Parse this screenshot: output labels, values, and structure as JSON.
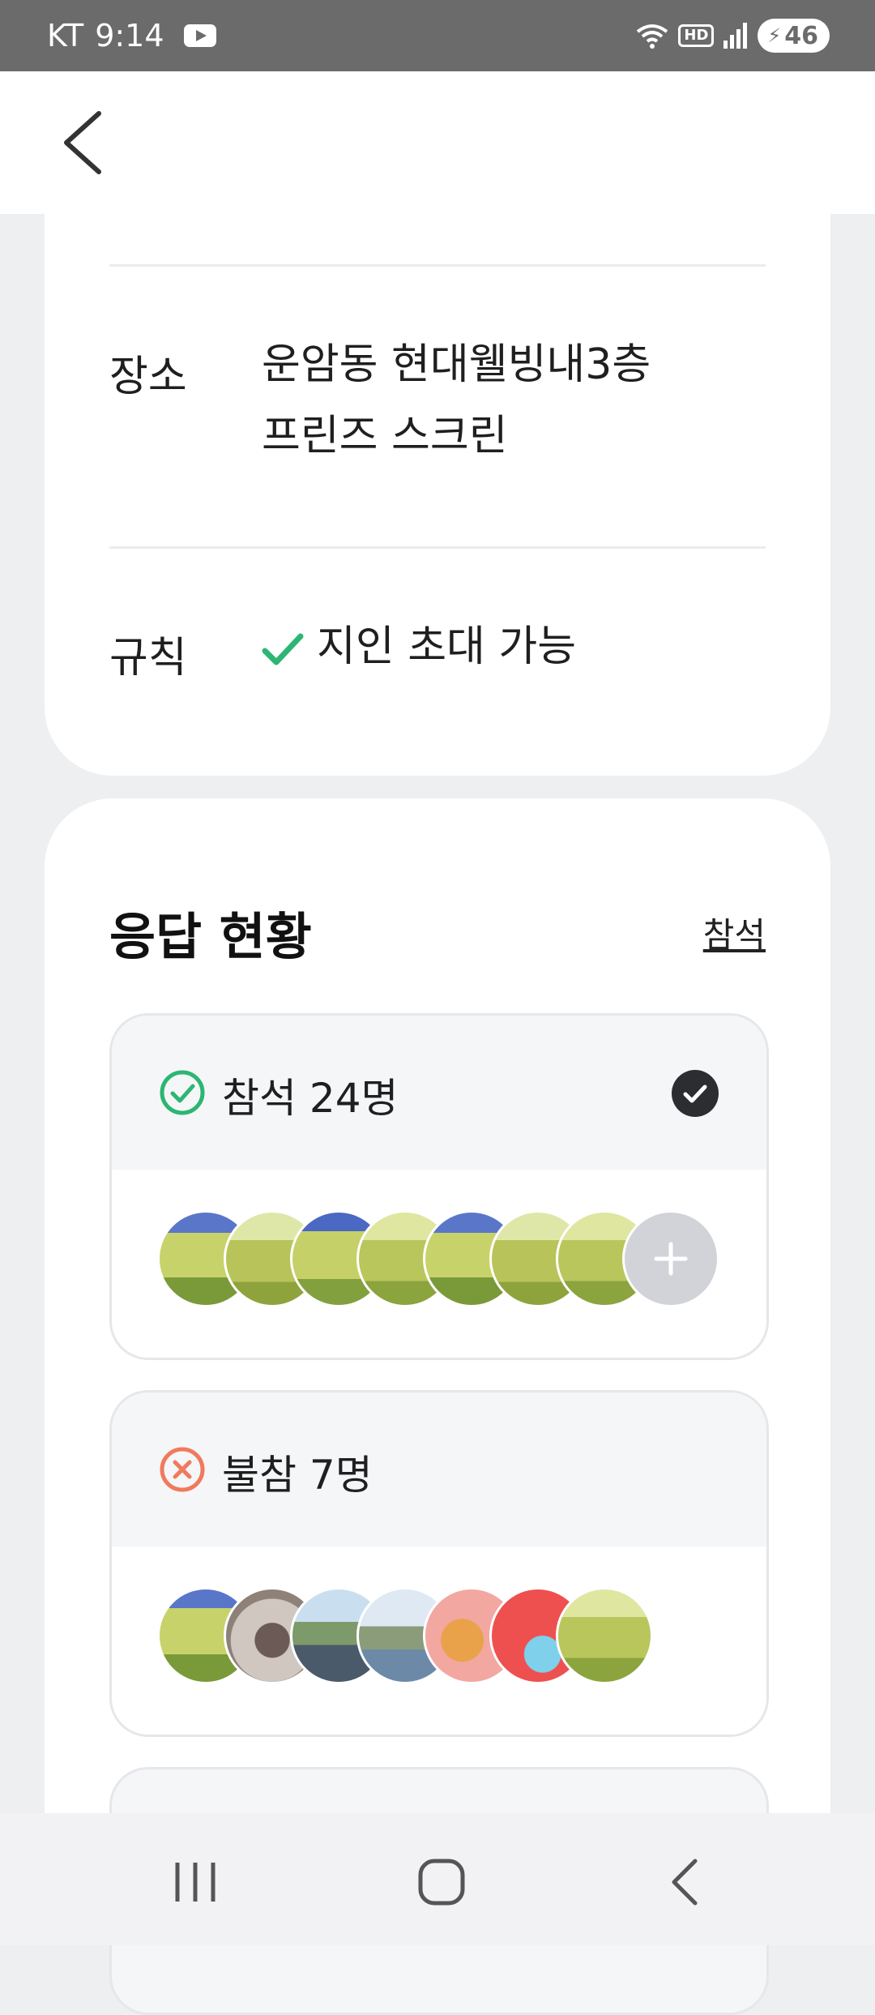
{
  "status_bar": {
    "carrier": "KT",
    "time": "9:14",
    "hd": "HD",
    "battery": "46"
  },
  "meeting": {
    "place_label": "장소",
    "place_line1": "운암동 현대웰빙내3층",
    "place_line2": "프린즈 스크린",
    "rule_label": "규칙",
    "rule_value": "지인 초대 가능"
  },
  "responses": {
    "title": "응답 현황",
    "filter_link": "참석",
    "attend": {
      "label": "참석 24명",
      "status_color": "#2cb673"
    },
    "absent": {
      "label": "불참 7명",
      "status_color": "#f07a5c"
    }
  },
  "colors": {
    "accent_green": "#2cb673",
    "accent_orange": "#f07a5c",
    "selected_dark": "#2b2d31"
  }
}
